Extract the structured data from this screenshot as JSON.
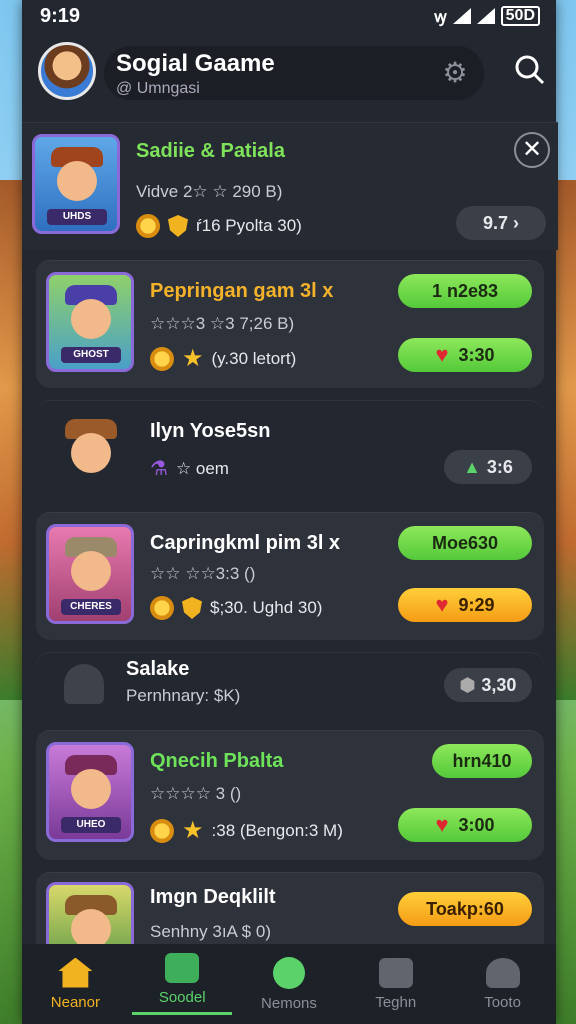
{
  "status": {
    "time": "9:19",
    "signal_label": "ꝡ",
    "battery": "50D"
  },
  "header": {
    "title": "Sogial Gaame",
    "subtitle": "@ Umngasi"
  },
  "cards": [
    {
      "name": "Sadiie & Patiala",
      "line2": "Vidve 2☆ ☆ 290 B)",
      "line3": "ŕ16 Pyolta 30)",
      "tag": "UHDS",
      "pill": "9.7",
      "name_color": "#7ee35a"
    },
    {
      "name": "Pepringan gam 3l x",
      "line2": "☆☆☆3 ☆3 7;26 B)",
      "line3": "(y.30 letort)",
      "tag": "GHOST",
      "pill_top": "1 n2e83",
      "pill_bottom": "3:30",
      "name_color": "#f4b22a"
    },
    {
      "name": "Ilyn Yose5sn",
      "line2": "☆ oem",
      "pill": "3:6",
      "name_color": "#ffffff"
    },
    {
      "name": "Capringkml pim 3l x",
      "line2": "☆☆ ☆☆3:3 () ",
      "line3": "$;30. Ughd 30)",
      "tag": "CHERES",
      "pill_top": "Moe630",
      "pill_bottom": "9:29",
      "name_color": "#ffffff"
    },
    {
      "name": "Salake",
      "line2": "Pernhnary: $K)",
      "pill": "3,30",
      "name_color": "#ffffff"
    },
    {
      "name": "Qnecih Pbalta",
      "line2": "☆☆☆☆ 3 ()",
      "line3": ":38 (Bengon:3 M)",
      "tag": "UHEO",
      "pill_top": "hrn410",
      "pill_bottom": "3:00",
      "name_color": "#6ee35a"
    },
    {
      "name": "Imgn Deqklilt",
      "line2": "Senhny 3ıA $ 0)",
      "pill": "Toakp:60",
      "name_color": "#ffffff"
    }
  ],
  "tabs": [
    {
      "label": "Neanor"
    },
    {
      "label": "Soodel"
    },
    {
      "label": "Nemons"
    },
    {
      "label": "Teghn"
    },
    {
      "label": "Tooto"
    }
  ],
  "colors": {
    "accent_green": "#5bd36a",
    "accent_orange": "#f59c14",
    "panel": "#2d323b"
  }
}
